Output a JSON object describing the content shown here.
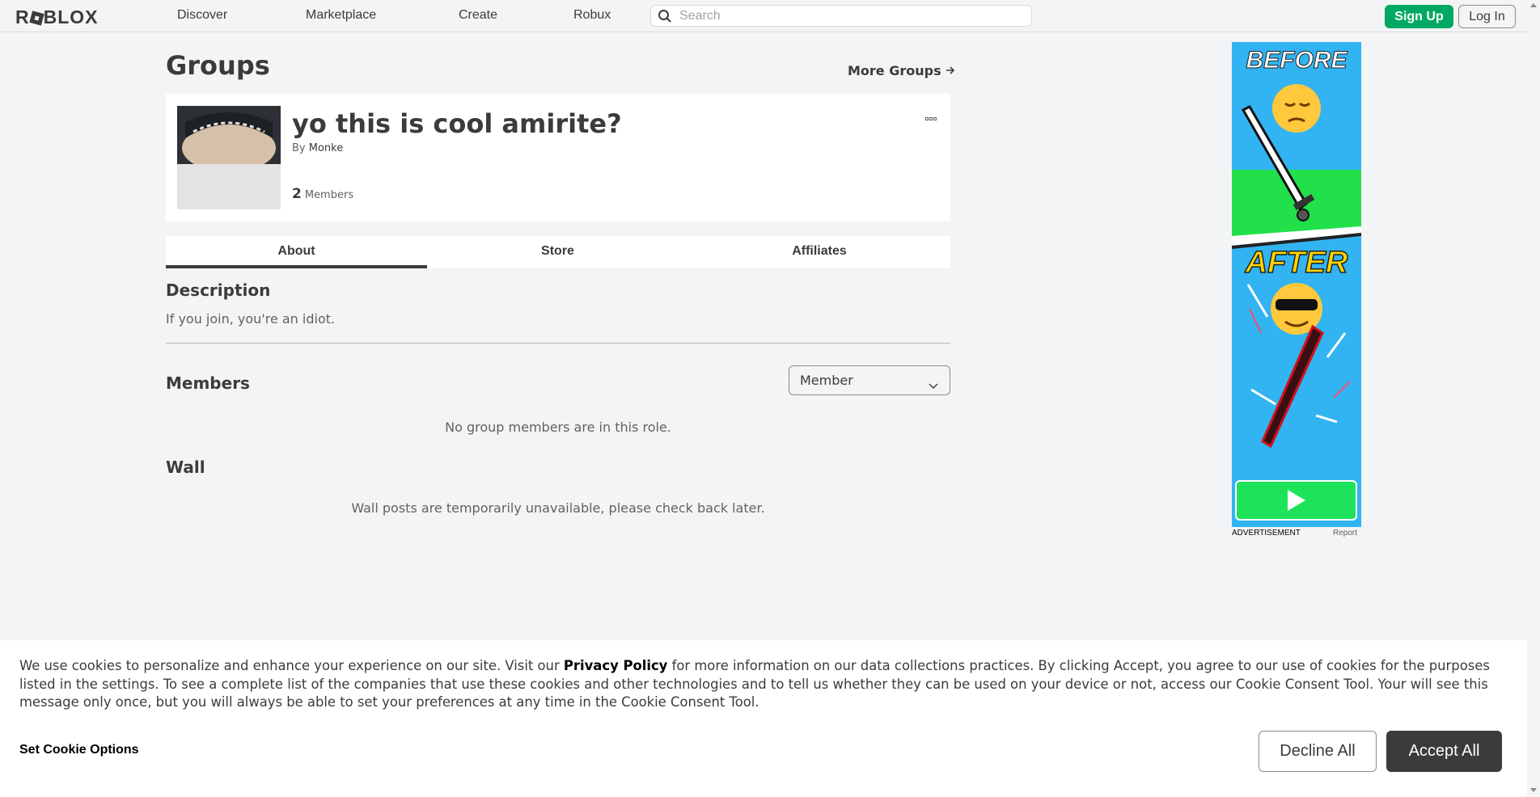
{
  "nav": {
    "logo": "ROBLOX",
    "links": [
      "Discover",
      "Marketplace",
      "Create",
      "Robux"
    ],
    "search_placeholder": "Search",
    "signup_label": "Sign Up",
    "login_label": "Log In",
    "accent_color": "#00a961"
  },
  "page": {
    "title": "Groups",
    "more_groups_label": "More Groups"
  },
  "group": {
    "name": "yo this is cool amirite?",
    "by_label": "By",
    "owner": "Monke",
    "member_count": "2",
    "members_label": "Members"
  },
  "tabs": [
    {
      "label": "About",
      "active": true
    },
    {
      "label": "Store",
      "active": false
    },
    {
      "label": "Affiliates",
      "active": false
    }
  ],
  "about": {
    "description_heading": "Description",
    "description_text": "If you join, you're an idiot.",
    "members_heading": "Members",
    "role_selected": "Member",
    "members_empty": "No group members are in this role.",
    "wall_heading": "Wall",
    "wall_empty": "Wall posts are temporarily unavailable, please check back later."
  },
  "ad": {
    "before_label": "BEFORE",
    "after_label": "AFTER",
    "caption": "ADVERTISEMENT",
    "report_label": "Report"
  },
  "cookie": {
    "text_before": "We use cookies to personalize and enhance your experience on our site. Visit our ",
    "privacy_link": "Privacy Policy",
    "text_after": " for more information on our data collections practices. By clicking Accept, you agree to our use of cookies for the purposes listed in the settings. To see a complete list of the companies that use these cookies and other technologies and to tell us whether they can be used on your device or not, access our Cookie Consent Tool. Your will see this message only once, but you will always be able to set your preferences at any time in the Cookie Consent Tool.",
    "options_label": "Set Cookie Options",
    "decline_label": "Decline All",
    "accept_label": "Accept All"
  }
}
